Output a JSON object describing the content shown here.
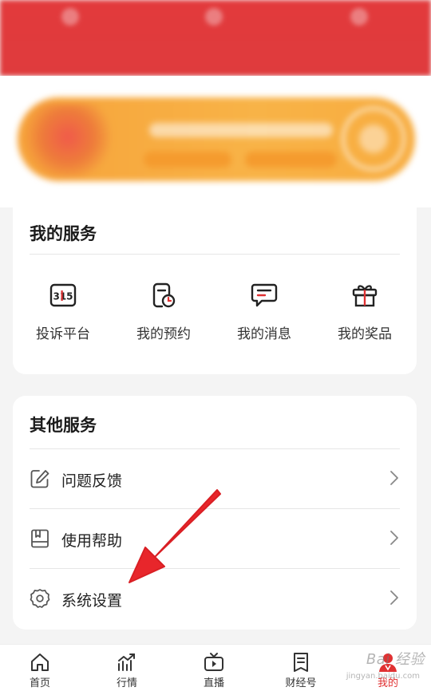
{
  "services": {
    "title": "我的服务",
    "items": [
      {
        "label": "投诉平台",
        "icon": "complaint-315-icon",
        "badge": "315"
      },
      {
        "label": "我的预约",
        "icon": "appointment-icon"
      },
      {
        "label": "我的消息",
        "icon": "message-icon"
      },
      {
        "label": "我的奖品",
        "icon": "gift-icon"
      }
    ]
  },
  "other": {
    "title": "其他服务",
    "items": [
      {
        "label": "问题反馈",
        "icon": "edit-feedback-icon"
      },
      {
        "label": "使用帮助",
        "icon": "help-book-icon"
      },
      {
        "label": "系统设置",
        "icon": "gear-icon"
      }
    ]
  },
  "nav": {
    "items": [
      {
        "label": "首页",
        "icon": "home-icon"
      },
      {
        "label": "行情",
        "icon": "market-chart-icon"
      },
      {
        "label": "直播",
        "icon": "live-tv-icon"
      },
      {
        "label": "财经号",
        "icon": "finance-account-icon"
      },
      {
        "label": "我的",
        "icon": "profile-icon",
        "active": true
      }
    ]
  },
  "colors": {
    "accent": "#e03132",
    "banner": "#f7ac3f",
    "topbar": "#e23a3c"
  },
  "watermark": {
    "text": "Bai 经验",
    "sub": "jingyan.baidu.com"
  }
}
